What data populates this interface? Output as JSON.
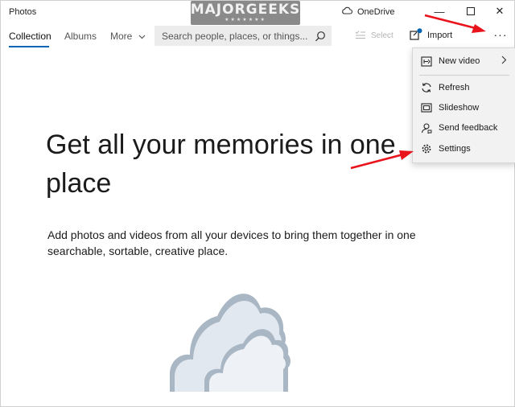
{
  "app": {
    "title": "Photos"
  },
  "watermark": {
    "text": "MAJORGEEKS",
    "stars": "★★★★★★★"
  },
  "titlebar": {
    "onedrive_label": "OneDrive",
    "minimize": "—",
    "maximize": "☐",
    "close": "✕"
  },
  "nav": {
    "items": [
      {
        "label": "Collection",
        "active": true
      },
      {
        "label": "Albums",
        "active": false
      },
      {
        "label": "More",
        "active": false
      }
    ],
    "more_chevron": "⌄"
  },
  "search": {
    "placeholder": "Search people, places, or things..."
  },
  "toolbar": {
    "select_label": "Select",
    "import_label": "Import",
    "more_label": "···"
  },
  "menu": {
    "items": [
      {
        "label": "New video",
        "icon": "video-edit-icon",
        "has_submenu": true
      },
      {
        "label": "Refresh",
        "icon": "refresh-icon"
      },
      {
        "label": "Slideshow",
        "icon": "slideshow-icon"
      },
      {
        "label": "Send feedback",
        "icon": "feedback-icon"
      },
      {
        "label": "Settings",
        "icon": "settings-gear-icon"
      }
    ],
    "submenu_chevron": "›"
  },
  "main": {
    "headline": "Get all your memories in one place",
    "description": "Add photos and videos from all your devices to bring them together in one searchable, sortable, creative place."
  },
  "colors": {
    "accent": "#0063b1",
    "annotation_arrow": "#e8131b",
    "cloud_fill": "#e2e8ef",
    "cloud_shadow": "#a9b6c4"
  }
}
